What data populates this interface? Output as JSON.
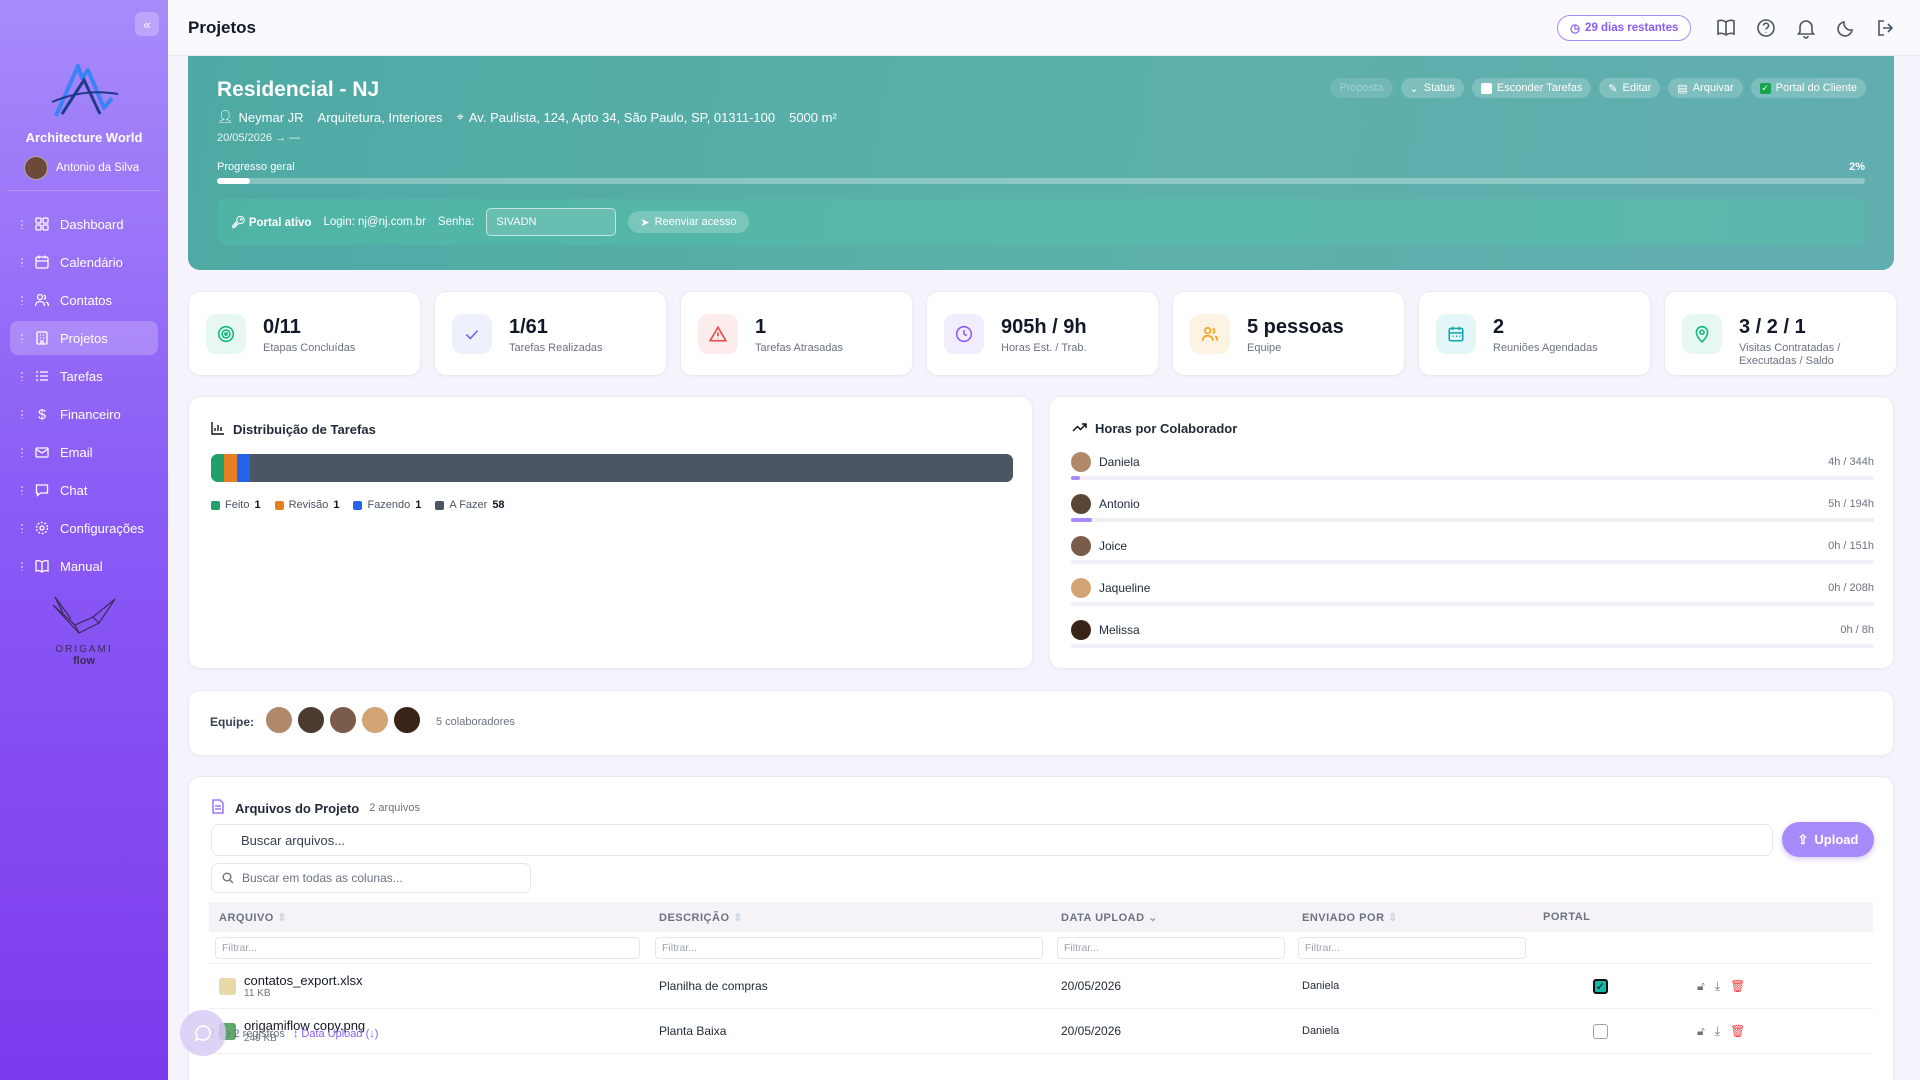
{
  "sidebar": {
    "app_name": "Architecture World",
    "user_name": "Antonio da Silva",
    "items": [
      {
        "label": "Dashboard",
        "icon": "grid-icon"
      },
      {
        "label": "Calendário",
        "icon": "calendar-icon"
      },
      {
        "label": "Contatos",
        "icon": "users-icon"
      },
      {
        "label": "Projetos",
        "icon": "building-icon",
        "active": true
      },
      {
        "label": "Tarefas",
        "icon": "list-icon"
      },
      {
        "label": "Financeiro",
        "icon": "dollar-icon"
      },
      {
        "label": "Email",
        "icon": "mail-icon"
      },
      {
        "label": "Chat",
        "icon": "chat-icon"
      },
      {
        "label": "Configurações",
        "icon": "gear-icon"
      },
      {
        "label": "Manual",
        "icon": "book-icon"
      }
    ],
    "brand_text": "ORIGAMI",
    "brand_sub": "flow"
  },
  "header": {
    "title": "Projetos",
    "trial": "29 dias restantes"
  },
  "project": {
    "name": "Residencial - NJ",
    "client": "Neymar JR",
    "category": "Arquitetura, Interiores",
    "address": "Av. Paulista, 124, Apto 34, São Paulo, SP, 01311-100",
    "area": "5000 m²",
    "dates": "20/05/2026 → —",
    "actions": {
      "proposta": "Proposta",
      "status": "Status",
      "hide_tasks": "Esconder Tarefas",
      "edit": "Editar",
      "archive": "Arquivar",
      "client_portal": "Portal do Cliente"
    },
    "progress_label": "Progresso geral",
    "progress_pct_label": "2%",
    "progress": 0.02,
    "portal": {
      "status": "Portal ativo",
      "login": "Login: nj@nj.com.br",
      "password_label": "Senha:",
      "password": "SIVADN",
      "resend": "Reenviar acesso"
    }
  },
  "stats": [
    {
      "value": "0/11",
      "label": "Etapas Concluídas",
      "icon": "target-icon",
      "color": "#10b981",
      "bg": "#e7f7f2"
    },
    {
      "value": "1/61",
      "label": "Tarefas Realizadas",
      "icon": "check-icon",
      "color": "#6366f1",
      "bg": "#eef0fd"
    },
    {
      "value": "1",
      "label": "Tarefas Atrasadas",
      "icon": "alert-icon",
      "color": "#ef4444",
      "bg": "#fdecec"
    },
    {
      "value": "905h / 9h",
      "label": "Horas Est. / Trab.",
      "icon": "clock-icon",
      "color": "#8b5cf6",
      "bg": "#f1ecfe"
    },
    {
      "value": "5 pessoas",
      "label": "Equipe",
      "icon": "team-icon",
      "color": "#f59e0b",
      "bg": "#fdf3e3"
    },
    {
      "value": "2",
      "label": "Reuniões Agendadas",
      "icon": "calendar-icon",
      "color": "#0ea5b7",
      "bg": "#e4f6f8"
    },
    {
      "value": "3 / 2 / 1",
      "label": "Visitas Contratadas / Executadas / Saldo",
      "icon": "pin-icon",
      "color": "#10b981",
      "bg": "#e7f7f2"
    }
  ],
  "distribution": {
    "title": "Distribuição de Tarefas",
    "segments": [
      {
        "label": "Feito",
        "count": "1",
        "value": 1,
        "color": "#22a06b"
      },
      {
        "label": "Revisão",
        "count": "1",
        "value": 1,
        "color": "#e67e22"
      },
      {
        "label": "Fazendo",
        "count": "1",
        "value": 1,
        "color": "#2563eb"
      },
      {
        "label": "A Fazer",
        "count": "58",
        "value": 58,
        "color": "#4b5563"
      }
    ]
  },
  "hours": {
    "title": "Horas por Colaborador",
    "people": [
      {
        "name": "Daniela",
        "hours": "4h / 344h",
        "fraction": 0.0116,
        "avatar_color": "#b08968"
      },
      {
        "name": "Antonio",
        "hours": "5h / 194h",
        "fraction": 0.0258,
        "avatar_color": "#5b4636"
      },
      {
        "name": "Joice",
        "hours": "0h / 151h",
        "fraction": 0,
        "avatar_color": "#7a5c4a"
      },
      {
        "name": "Jaqueline",
        "hours": "0h / 208h",
        "fraction": 0,
        "avatar_color": "#d4a373"
      },
      {
        "name": "Melissa",
        "hours": "0h / 8h",
        "fraction": 0,
        "avatar_color": "#3a2418"
      }
    ]
  },
  "team": {
    "label": "Equipe:",
    "count": "5 colaboradores",
    "avatar_colors": [
      "#b08968",
      "#4a3a30",
      "#7a5c4a",
      "#d4a373",
      "#3a2418"
    ]
  },
  "files": {
    "title": "Arquivos do Projeto",
    "count": "2 arquivos",
    "search_placeholder": "Buscar arquivos...",
    "upload": "Upload",
    "column_search": "Buscar em todas as colunas...",
    "columns": [
      "ARQUIVO",
      "DESCRIÇÃO",
      "DATA UPLOAD",
      "ENVIADO POR",
      "PORTAL"
    ],
    "filter_placeholder": "Filtrar...",
    "rows": [
      {
        "name": "contatos_export.xlsx",
        "size": "11 KB",
        "description": "Planilha de compras",
        "date": "20/05/2026",
        "by": "Daniela",
        "portal": true,
        "icon_color": "#e8d9a8"
      },
      {
        "name": "origamiflow copy.png",
        "size": "249 KB",
        "description": "Planta Baixa",
        "date": "20/05/2026",
        "by": "Daniela",
        "portal": false,
        "icon_color": "#5fa86a"
      }
    ],
    "footer_count": "2 de 2 registros",
    "footer_sort": "↕ Data Upload (↓)"
  }
}
